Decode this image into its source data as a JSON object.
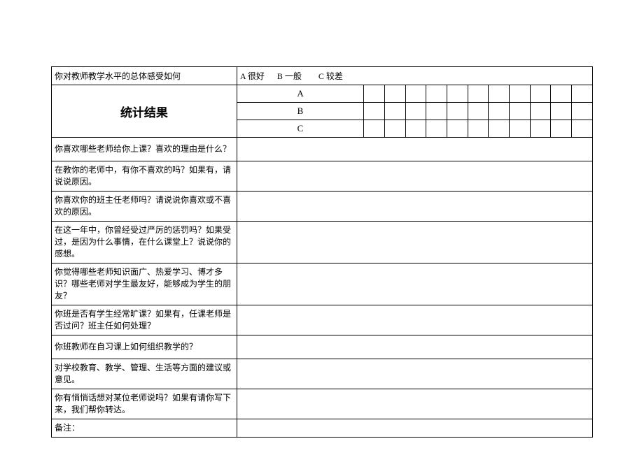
{
  "row_rating": {
    "question": "你对教师教学水平的总体感受如何",
    "options": "A 很好      B 一般        C 较差"
  },
  "stats_header": "统计结果",
  "letters": {
    "a": "A",
    "b": "B",
    "c": "C"
  },
  "open_questions": {
    "q1": "你喜欢哪些老师给你上课？喜欢的理由是什么？",
    "q2": "在教你的老师中，有你不喜欢的吗？如果有，请说说原因。",
    "q3": "你喜欢你的班主任老师吗？请说说你喜欢或不喜欢的原因。",
    "q4": "在这一年中，你曾经受过严厉的惩罚吗？如果受过，是因为什么事情，在什么课堂上？说说你的感想。",
    "q5": "你觉得哪些老师知识面广、热爱学习、博才多识？哪些老师对学生最友好，能够成为学生的朋友？",
    "q6": "你班是否有学生经常旷课？如果有，任课老师是否过问？班主任如何处理？",
    "q7": "你班教师在自习课上如何组织教学的？",
    "q8": "对学校教育、教学、管理、生活等方面的建议或意见。",
    "q9": "你有悄悄话想对某位老师说吗？如果有请你写下来，我们帮你转达。",
    "q10": "备注："
  }
}
